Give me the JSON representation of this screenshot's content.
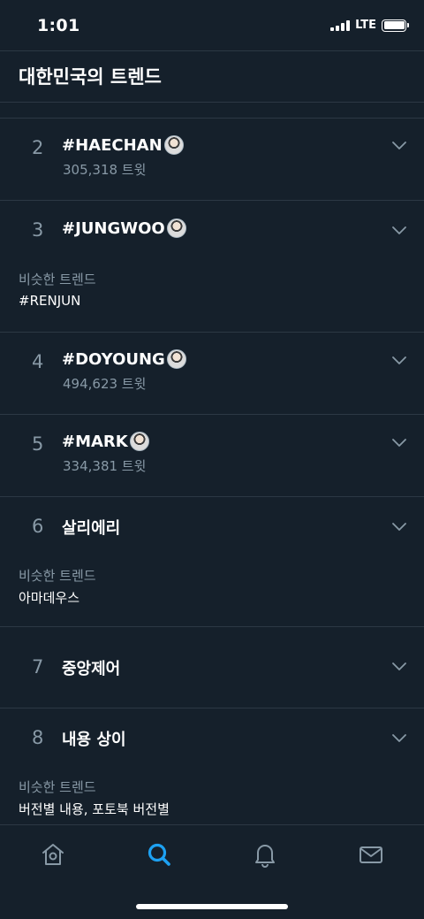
{
  "status_bar": {
    "time": "1:01",
    "network": "LTE"
  },
  "header": {
    "title": "대한민국의 트렌드"
  },
  "trends": [
    {
      "rank": "2",
      "name": "#HAECHAN",
      "count": "305,318 트윗"
    },
    {
      "rank": "3",
      "name": "#JUNGWOO",
      "similar_label": "비슷한 트렌드",
      "similar": "#RENJUN"
    },
    {
      "rank": "4",
      "name": "#DOYOUNG",
      "count": "494,623 트윗"
    },
    {
      "rank": "5",
      "name": "#MARK",
      "count": "334,381 트윗"
    },
    {
      "rank": "6",
      "name": "살리에리",
      "similar_label": "비슷한 트렌드",
      "similar": "아마데우스"
    },
    {
      "rank": "7",
      "name": "중앙제어"
    },
    {
      "rank": "8",
      "name": "내용 상이",
      "similar_label": "비슷한 트렌드",
      "similar": "버전별 내용, 포토북 버전별"
    }
  ],
  "tab_bar": {
    "tabs": [
      {
        "icon": "home-icon"
      },
      {
        "icon": "search-icon",
        "active": true
      },
      {
        "icon": "bell-icon"
      },
      {
        "icon": "mail-icon"
      }
    ],
    "accent": "#1da1f2",
    "inactive": "#8899a6"
  },
  "colors": {
    "background": "#15202b",
    "divider": "#2c3844",
    "secondary_text": "#8899a6"
  }
}
